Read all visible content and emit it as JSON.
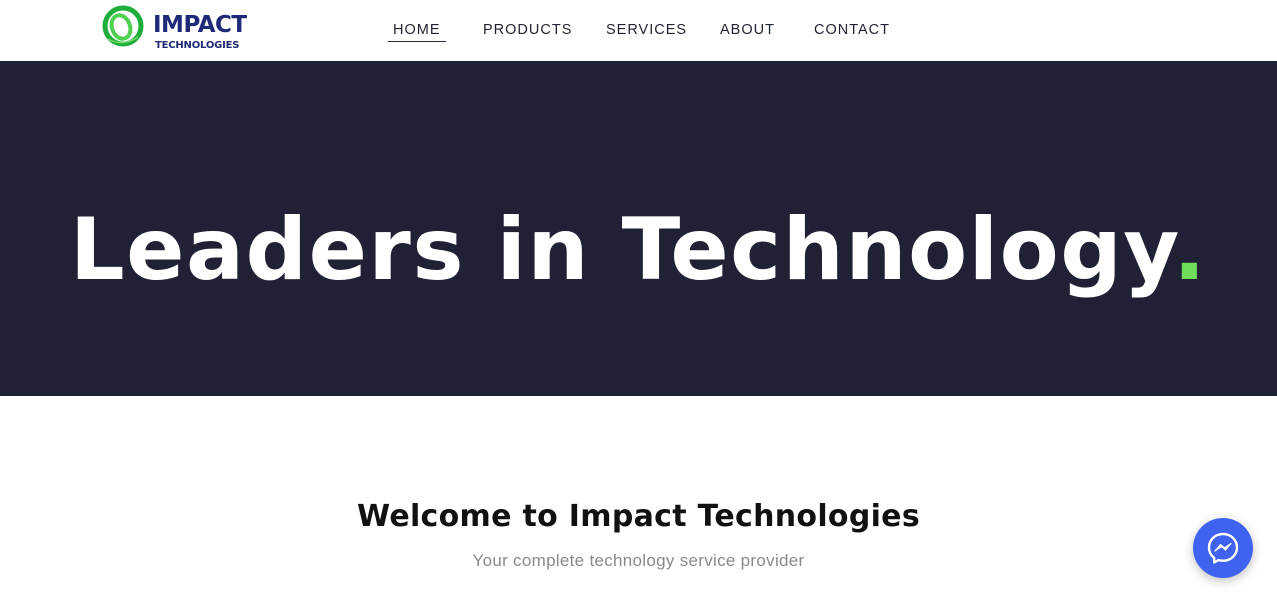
{
  "logo": {
    "title": "IMPACT",
    "subtitle": "TECHNOLOGIES",
    "icon": "ring-logo-icon"
  },
  "nav": {
    "items": [
      {
        "label": "HOME",
        "active": true
      },
      {
        "label": "PRODUCTS",
        "active": false
      },
      {
        "label": "SERVICES",
        "active": false
      },
      {
        "label": "ABOUT",
        "active": false
      },
      {
        "label": "CONTACT",
        "active": false
      }
    ]
  },
  "hero": {
    "title": "Leaders  in Technology",
    "accent_dot": "."
  },
  "welcome": {
    "title": "Welcome to Impact Technologies",
    "subtitle": "Your complete technology service provider"
  },
  "messenger": {
    "icon": "messenger-icon"
  },
  "colors": {
    "brand_blue": "#1e2a78",
    "brand_green": "#2dbb3a",
    "hero_background": "#202134",
    "accent_green": "#6fdc5a",
    "messenger_blue": "#3f63f0"
  }
}
